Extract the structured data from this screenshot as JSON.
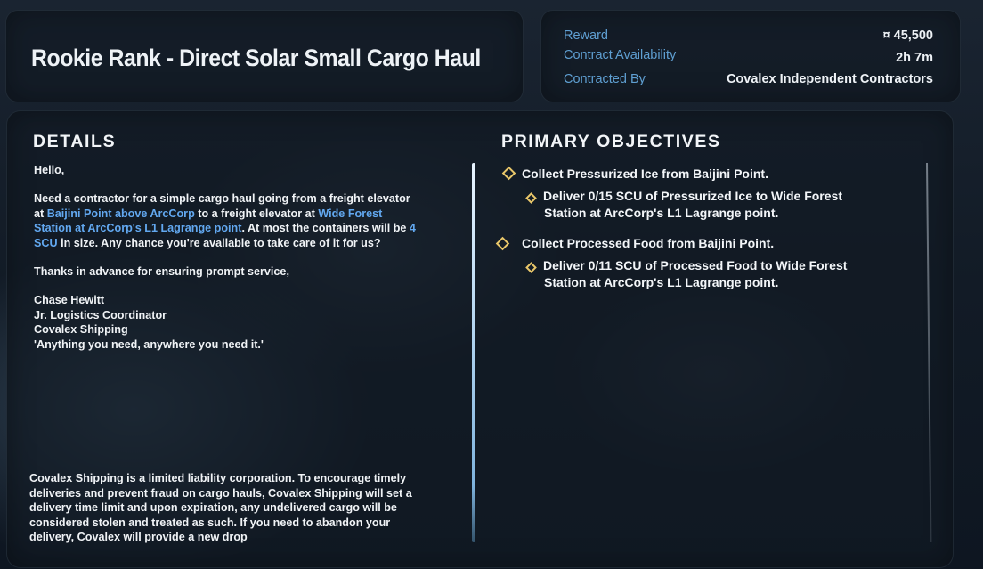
{
  "contract": {
    "title": "Rookie Rank - Direct Solar Small Cargo Haul",
    "info": [
      {
        "label": "Reward",
        "value": "¤ 45,500"
      },
      {
        "label": "Contract Availability",
        "value": "2h 7m"
      },
      {
        "label": "Contracted By",
        "value": "Covalex Independent Contractors"
      }
    ]
  },
  "details": {
    "heading": "DETAILS",
    "greeting": "Hello,",
    "body": {
      "t1": "Need a contractor for a simple cargo haul going from a freight elevator at ",
      "hl1": "Baijini Point above ArcCorp",
      "t2": " to a freight elevator at ",
      "hl2": "Wide Forest Station at ArcCorp's L1 Lagrange point",
      "t3": ". At most the containers will be ",
      "hl3": "4 SCU",
      "t4": " in size. Any chance you're available to take care of it for us?"
    },
    "thanks": "Thanks in advance for ensuring prompt service,",
    "signature": [
      "Chase Hewitt",
      "Jr. Logistics Coordinator",
      "Covalex Shipping",
      "'Anything you need, anywhere you need it.'"
    ],
    "footer": "Covalex Shipping is a limited liability corporation. To encourage timely deliveries and prevent fraud on cargo hauls, Covalex Shipping will set a delivery time limit and upon expiration, any undelivered cargo will be considered stolen and treated as such. If you need to abandon your delivery, Covalex will provide a new drop"
  },
  "objectives": {
    "heading": "PRIMARY OBJECTIVES",
    "items": [
      {
        "text": "Collect Pressurized Ice from Baijini Point.",
        "sub": [
          "Deliver 0/15 SCU of Pressurized Ice to Wide Forest",
          "Station at ArcCorp's L1 Lagrange point."
        ]
      },
      {
        "text": "Collect Processed Food from Baijini Point.",
        "sub": [
          "Deliver 0/11 SCU of Processed Food to Wide Forest",
          "Station at ArcCorp's L1 Lagrange point."
        ]
      }
    ]
  },
  "colors": {
    "accent": "#62a8f0",
    "objective_marker": "#e9c76a"
  }
}
